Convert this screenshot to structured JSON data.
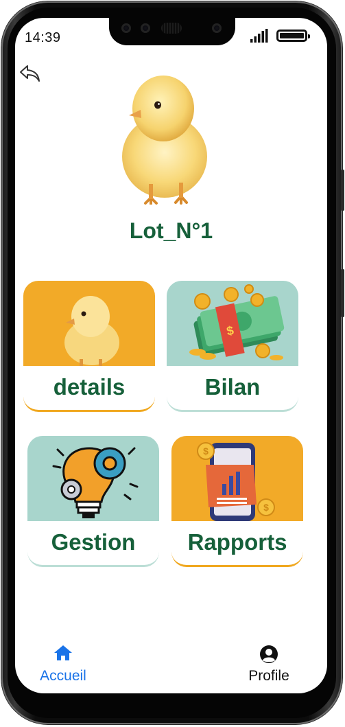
{
  "status_bar": {
    "time": "14:39"
  },
  "page": {
    "title": "Lot_N°1"
  },
  "icons": {
    "back": "back-arrow-icon",
    "hero": "chick-image",
    "home": "home-icon",
    "profile": "user-circle-icon"
  },
  "cards": [
    {
      "label": "details",
      "image": "chick-image"
    },
    {
      "label": "Bilan",
      "image": "money-stack-image"
    },
    {
      "label": "Gestion",
      "image": "lightbulb-gears-image"
    },
    {
      "label": "Rapports",
      "image": "phone-report-image"
    }
  ],
  "bottom_nav": [
    {
      "label": "Accueil",
      "icon": "home-icon",
      "active": true
    },
    {
      "label": "Profile",
      "icon": "user-circle-icon",
      "active": false
    }
  ],
  "colors": {
    "title_green": "#16603a",
    "card_yellow": "#f2aa28",
    "card_teal": "#a8d5cc",
    "nav_active": "#1a73e8"
  }
}
